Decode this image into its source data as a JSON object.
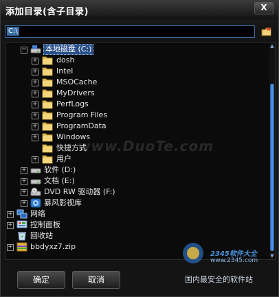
{
  "window": {
    "title": "添加目录(含子目录)",
    "close_label": "X"
  },
  "path": {
    "value": "C:\\"
  },
  "tree": {
    "drive_c": "本地磁盘 (C:)",
    "c_folders": [
      {
        "label": "dosh",
        "expandable": true
      },
      {
        "label": "Intel",
        "expandable": true
      },
      {
        "label": "MSOCache",
        "expandable": true
      },
      {
        "label": "MyDrivers",
        "expandable": true
      },
      {
        "label": "PerfLogs",
        "expandable": true
      },
      {
        "label": "Program Files",
        "expandable": true
      },
      {
        "label": "ProgramData",
        "expandable": true
      },
      {
        "label": "Windows",
        "expandable": true
      },
      {
        "label": "快捷方式",
        "expandable": false
      },
      {
        "label": "用户",
        "expandable": true
      }
    ],
    "drives": [
      "软件 (D:)",
      "文档 (E:)",
      "DVD RW 驱动器 (F:)",
      "暴风影视库"
    ],
    "roots": [
      "网络",
      "控制面板",
      "回收站",
      "bbdyxz7.zip"
    ]
  },
  "buttons": {
    "ok": "确定",
    "cancel": "取消"
  },
  "watermark": {
    "site": "www.DuoTe.com",
    "brand": "2345软件大全",
    "url": "www.2345.com",
    "slogan": "国内最安全的软件站"
  }
}
